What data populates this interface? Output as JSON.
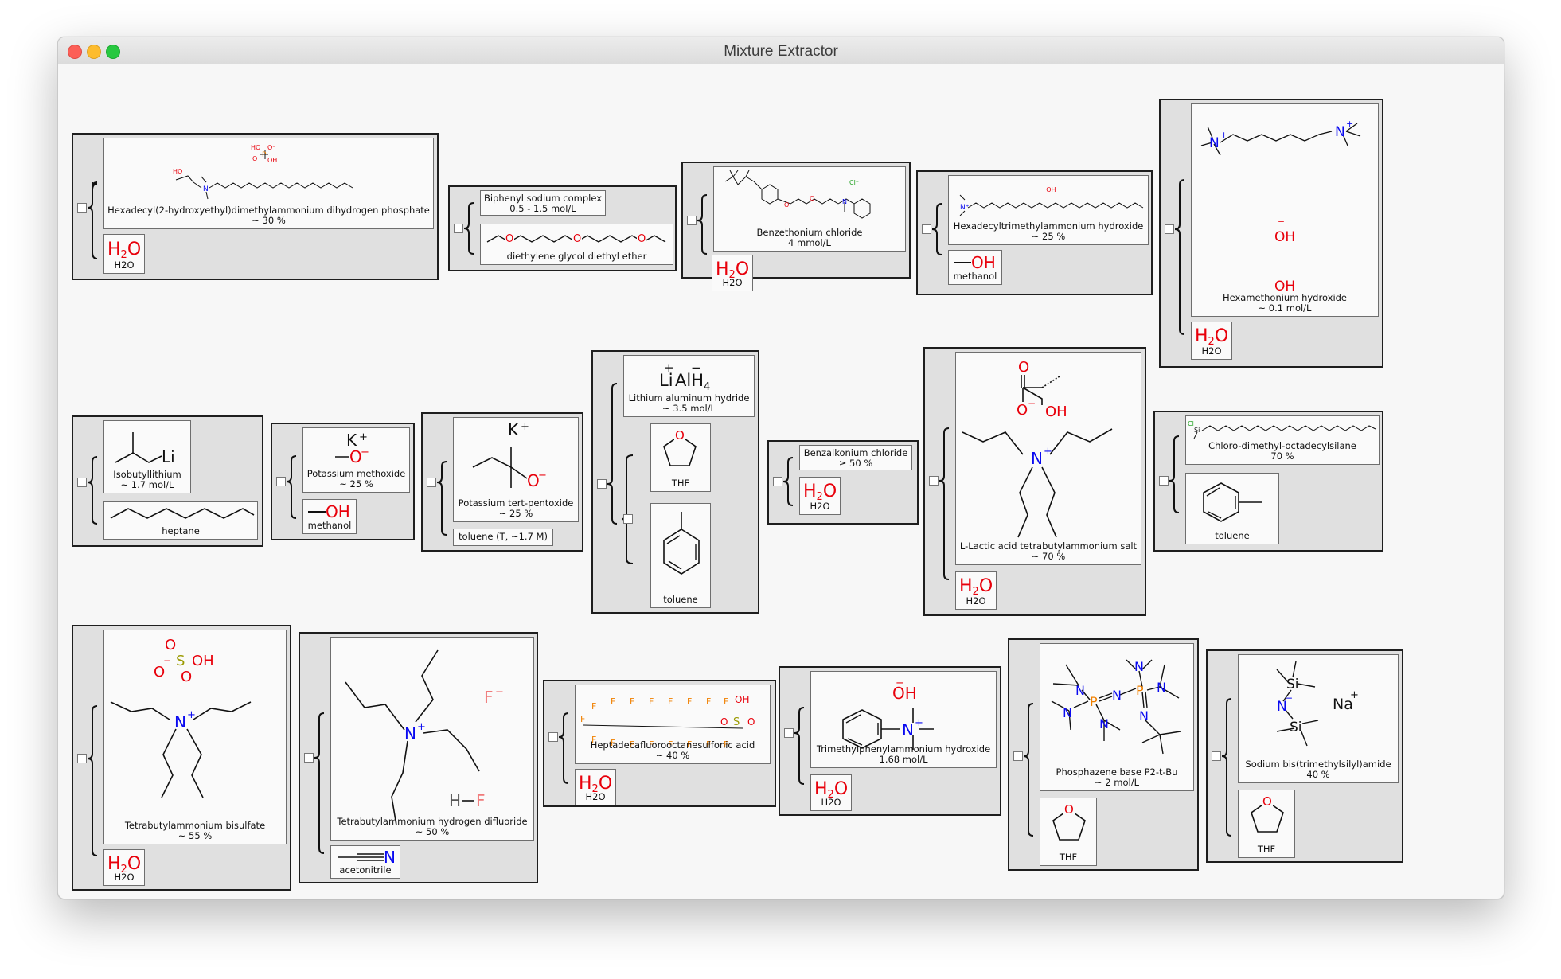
{
  "window": {
    "title": "Mixture Extractor"
  },
  "mixtures": [
    {
      "components": [
        {
          "name": "Hexadecyl(2-hydroxyethyl)dimethylammonium dihydrogen phosphate",
          "amount": "~ 30 %"
        },
        {
          "name": "H2O",
          "formula": "H2O"
        }
      ]
    },
    {
      "components": [
        {
          "name": "Biphenyl sodium complex",
          "amount": "0.5 - 1.5 mol/L"
        },
        {
          "name": "diethylene glycol diethyl ether"
        }
      ]
    },
    {
      "components": [
        {
          "name": "Benzethonium chloride",
          "amount": "4 mmol/L"
        },
        {
          "name": "H2O",
          "formula": "H2O"
        }
      ]
    },
    {
      "components": [
        {
          "name": "Hexadecyltrimethylammonium hydroxide",
          "amount": "~ 25 %"
        },
        {
          "name": "methanol",
          "formula": "—OH"
        }
      ]
    },
    {
      "components": [
        {
          "name": "Hexamethonium hydroxide",
          "amount": "~ 0.1 mol/L"
        },
        {
          "name": "H2O",
          "formula": "H2O"
        }
      ]
    },
    {
      "components": [
        {
          "name": "Isobutyllithium",
          "amount": "~ 1.7 mol/L"
        },
        {
          "name": "heptane"
        }
      ]
    },
    {
      "components": [
        {
          "name": "Potassium methoxide",
          "amount": "~ 25 %"
        },
        {
          "name": "methanol",
          "formula": "—OH"
        }
      ]
    },
    {
      "components": [
        {
          "name": "Potassium tert-pentoxide",
          "amount": "~ 25 %"
        },
        {
          "name": "toluene (T, ~1.7 M)"
        }
      ]
    },
    {
      "components": [
        {
          "name": "Lithium aluminum hydride",
          "amount": "~ 3.5 mol/L"
        },
        {
          "name": "THF"
        },
        {
          "name": "toluene"
        }
      ]
    },
    {
      "components": [
        {
          "name": "Benzalkonium chloride",
          "amount": "≥ 50 %"
        },
        {
          "name": "H2O",
          "formula": "H2O"
        }
      ]
    },
    {
      "components": [
        {
          "name": "L-Lactic acid tetrabutylammonium salt",
          "amount": "~ 70 %"
        },
        {
          "name": "H2O",
          "formula": "H2O"
        }
      ]
    },
    {
      "components": [
        {
          "name": "Chloro-dimethyl-octadecylsilane",
          "amount": "70 %"
        },
        {
          "name": "toluene"
        }
      ]
    },
    {
      "components": [
        {
          "name": "Tetrabutylammonium bisulfate",
          "amount": "~ 55 %"
        },
        {
          "name": "H2O",
          "formula": "H2O"
        }
      ]
    },
    {
      "components": [
        {
          "name": "Tetrabutylammonium hydrogen difluoride",
          "amount": "~ 50 %"
        },
        {
          "name": "acetonitrile"
        }
      ]
    },
    {
      "components": [
        {
          "name": "Heptadecafluorooctanesulfonic acid",
          "amount": "~ 40 %"
        },
        {
          "name": "H2O",
          "formula": "H2O"
        }
      ]
    },
    {
      "components": [
        {
          "name": "Trimethylphenylammonium hydroxide",
          "amount": "1.68 mol/L"
        },
        {
          "name": "H2O",
          "formula": "H2O"
        }
      ]
    },
    {
      "components": [
        {
          "name": "Phosphazene base P2-t-Bu",
          "amount": "~ 2 mol/L"
        },
        {
          "name": "THF"
        }
      ]
    },
    {
      "components": [
        {
          "name": "Sodium bis(trimethylsilyl)amide",
          "amount": "40 %"
        },
        {
          "name": "THF"
        }
      ]
    }
  ],
  "atom_labels": {
    "n": "N",
    "o": "O",
    "oh": "OH",
    "p": "P",
    "s": "S",
    "f": "F",
    "si": "Si",
    "na": "Na",
    "li": "Li",
    "k": "K",
    "cl": "Cl",
    "h": "H",
    "al": "Al",
    "plus": "+",
    "minus": "−",
    "ho": "HO"
  },
  "colors": {
    "heteroatom_red": "#e8000b",
    "nitrogen_blue": "#0a0af0",
    "phosphorus_orange": "#f08000",
    "chlorine_green": "#1fa01f",
    "sulfur_olive": "#9a9a00",
    "fluorine_pink": "#f07a7a"
  }
}
